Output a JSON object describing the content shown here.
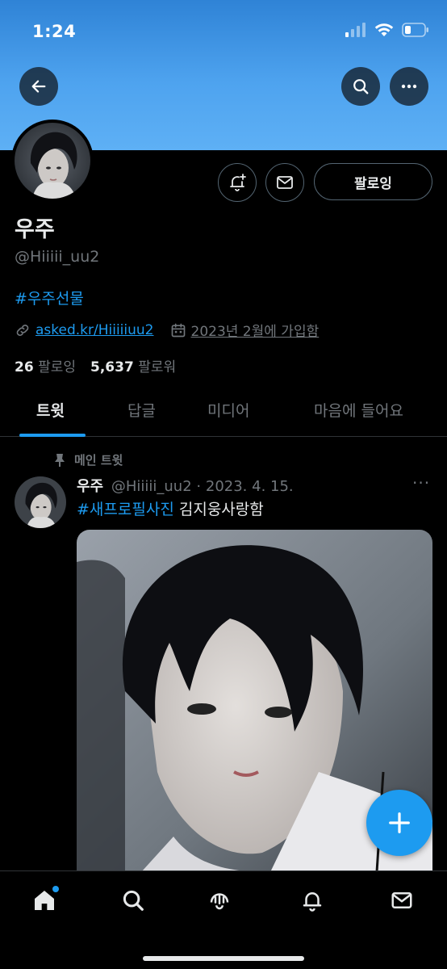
{
  "status_bar": {
    "time": "1:24"
  },
  "profile": {
    "display_name": "우주",
    "handle": "@Hiiiii_uu2",
    "bio_hashtag": "#우주선물",
    "link": "asked.kr/Hiiiiiuu2",
    "joined": "2023년 2월에 가입함",
    "following_count": "26",
    "following_label": "팔로잉",
    "followers_count": "5,637",
    "followers_label": "팔로워",
    "follow_button_label": "팔로잉"
  },
  "tabs": [
    {
      "label": "트윗",
      "active": true
    },
    {
      "label": "답글",
      "active": false
    },
    {
      "label": "미디어",
      "active": false
    },
    {
      "label": "마음에 들어요",
      "active": false
    }
  ],
  "pinned_tweet": {
    "pinned_label": "메인 트윗",
    "author_name": "우주",
    "author_handle": "@Hiiiii_uu2",
    "separator": "·",
    "date": "2023. 4. 15.",
    "more": "···",
    "hashtag": "#새프로필사진",
    "text": "김지웅사랑함"
  },
  "icons": {
    "back": "back-arrow-icon",
    "search": "search-icon",
    "more": "more-icon",
    "notify": "bell-plus-icon",
    "dm": "envelope-icon",
    "link": "link-icon",
    "calendar": "calendar-icon",
    "pin": "pin-icon",
    "compose": "plus-icon",
    "nav": [
      "home-icon",
      "search-icon",
      "spaces-icon",
      "bell-icon",
      "envelope-icon"
    ]
  },
  "colors": {
    "accent": "#1d9bf0",
    "banner": "#4ea3ef",
    "background": "#000000",
    "muted": "#71767b"
  }
}
